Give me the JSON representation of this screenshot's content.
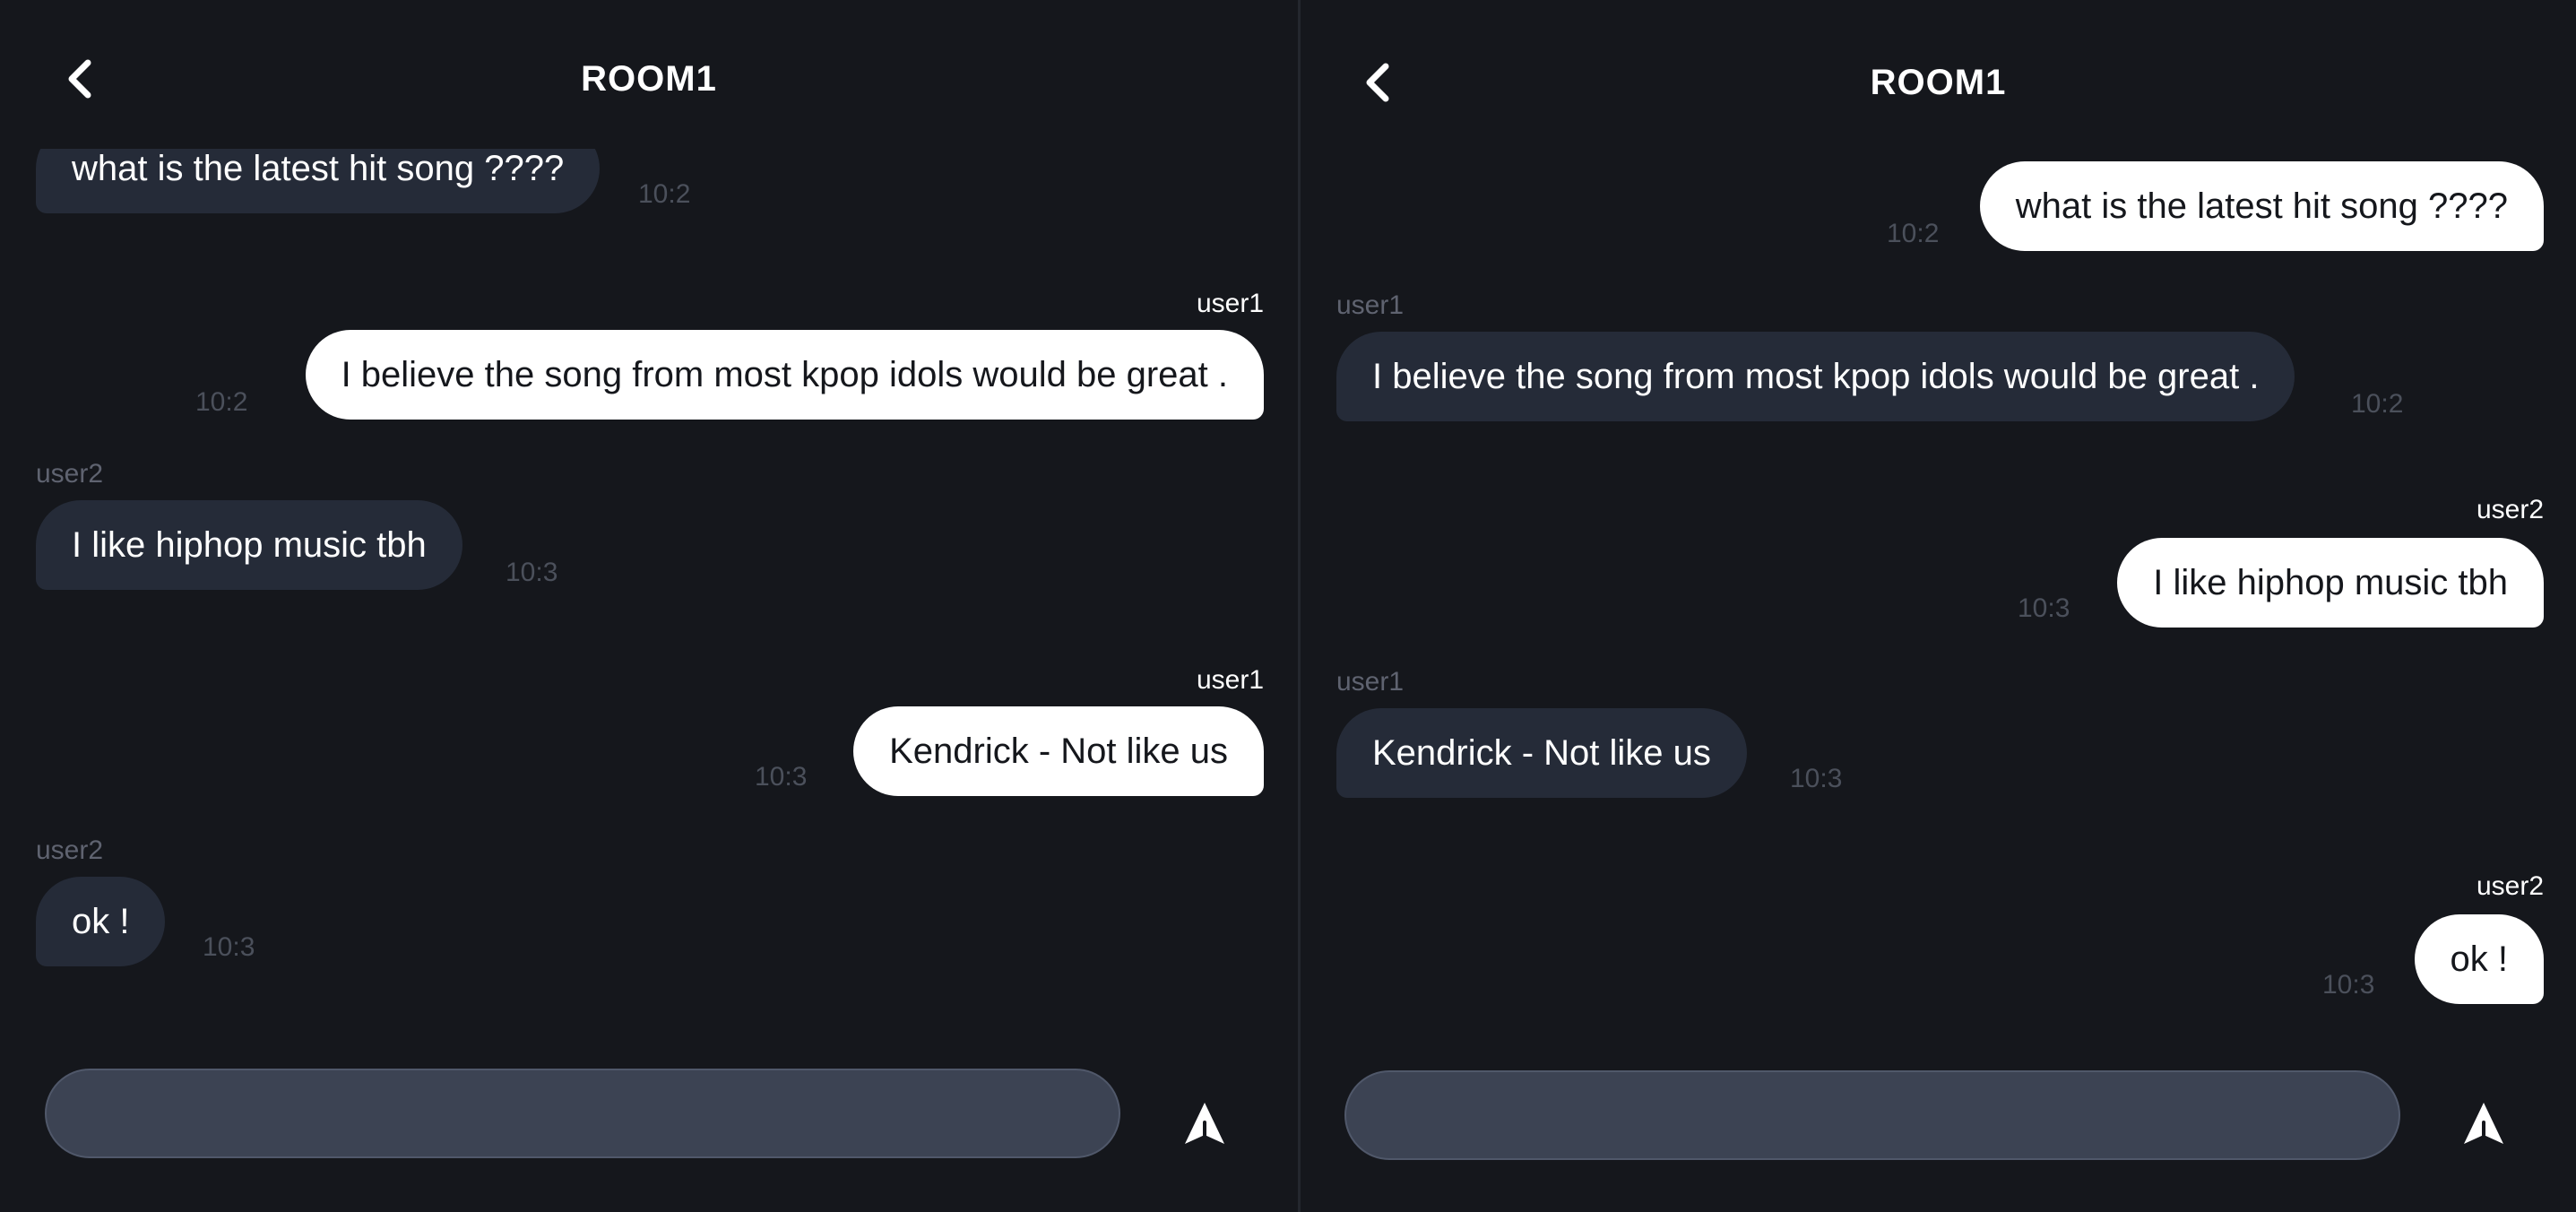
{
  "panes": {
    "left": {
      "header": {
        "title": "ROOM1",
        "back_icon": "chevron-left-icon"
      },
      "messages": [
        {
          "text": "what is the latest hit song ????",
          "time": "10:2"
        },
        {
          "sender": "user1",
          "text": "I believe the song from most kpop idols would be great .",
          "time": "10:2"
        },
        {
          "sender": "user2",
          "text": "I like hiphop music tbh",
          "time": "10:3"
        },
        {
          "sender": "user1",
          "text": "Kendrick - Not like us",
          "time": "10:3"
        },
        {
          "sender": "user2",
          "text": "ok !",
          "time": "10:3"
        }
      ],
      "composer": {
        "input_value": "",
        "send_icon": "send-arrow-icon"
      }
    },
    "right": {
      "header": {
        "title": "ROOM1",
        "back_icon": "chevron-left-icon"
      },
      "messages": [
        {
          "text": "what is the latest hit song ????",
          "time": "10:2"
        },
        {
          "sender": "user1",
          "text": "I believe the song from most kpop idols would be great .",
          "time": "10:2"
        },
        {
          "sender": "user2",
          "text": "I like hiphop music tbh",
          "time": "10:3"
        },
        {
          "sender": "user1",
          "text": "Kendrick - Not like us",
          "time": "10:3"
        },
        {
          "sender": "user2",
          "text": "ok !",
          "time": "10:3"
        }
      ],
      "composer": {
        "input_value": "",
        "send_icon": "send-arrow-icon"
      }
    }
  },
  "colors": {
    "background": "#15171c",
    "outgoing_bubble": "#ffffff",
    "incoming_bubble": "#252b38",
    "input_background": "#3c4353",
    "timestamp": "#4b505b"
  }
}
